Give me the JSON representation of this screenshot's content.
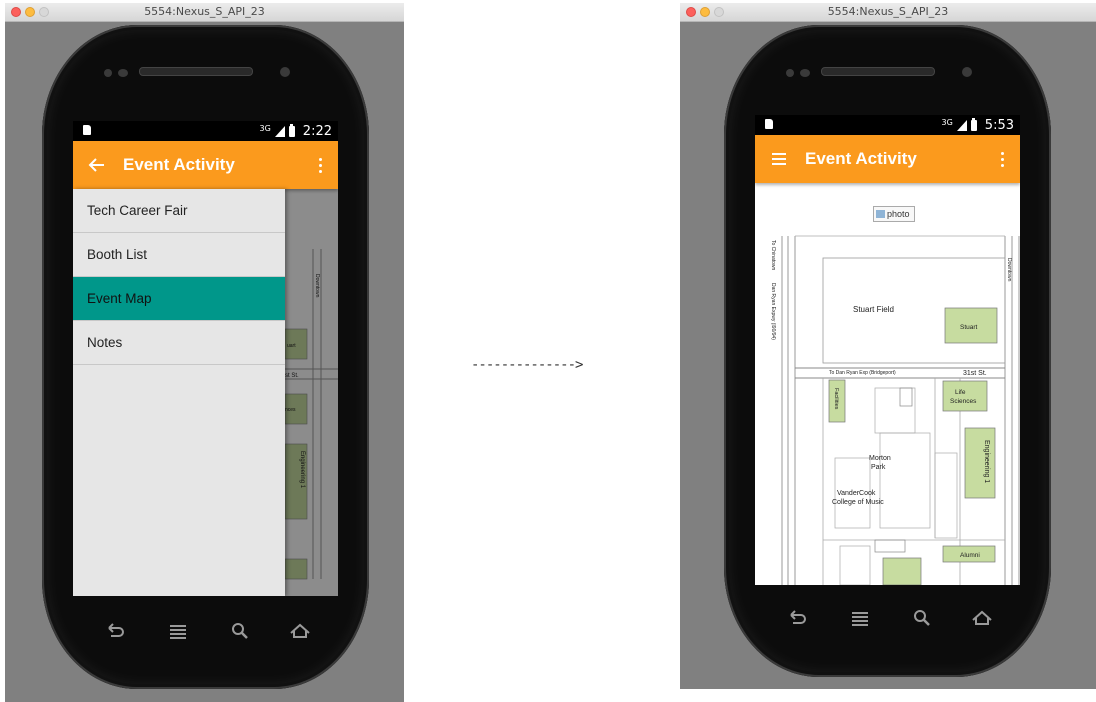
{
  "left_window": {
    "title": "5554:Nexus_S_API_23",
    "status": {
      "network": "3G",
      "time": "2:22"
    },
    "app_bar": {
      "title": "Event Activity",
      "nav_icon": "back-arrow-icon"
    },
    "drawer": {
      "items": [
        {
          "label": "Tech Career Fair",
          "active": false
        },
        {
          "label": "Booth List",
          "active": false
        },
        {
          "label": "Event Map",
          "active": true
        },
        {
          "label": "Notes",
          "active": false
        }
      ]
    },
    "background_map_labels": {
      "downtown": "Downtown",
      "stuart": "uart",
      "st31": "st St.",
      "sciences": "nces",
      "engineering": "Engineering 1"
    }
  },
  "transition_arrow": "-------------->",
  "right_window": {
    "title": "5554:Nexus_S_API_23",
    "status": {
      "network": "3G",
      "time": "5:53"
    },
    "app_bar": {
      "title": "Event Activity",
      "nav_icon": "hamburger-menu-icon"
    },
    "image_alt": "photo",
    "map_labels": {
      "chinatown": "To Chinatown",
      "dan_ryan": "Dan Ryan Expwy (I90/94)",
      "downtown": "Downtown",
      "stuart_field": "Stuart Field",
      "stuart": "Stuart",
      "to_dan_ryan": "To Dan Ryan Exp (Bridgeport)",
      "st31": "31st St.",
      "facilities": "Facilities",
      "life": "Life",
      "sciences": "Sciences",
      "morton": "Morton",
      "park": "Park",
      "engineering": "Engineering 1",
      "vandercook": "VanderCook",
      "college_music": "College of Music",
      "alumni": "Alumni"
    }
  },
  "colors": {
    "app_bar": "#fb9a1d",
    "drawer_active": "#00978a",
    "building": "#c7dca0"
  }
}
